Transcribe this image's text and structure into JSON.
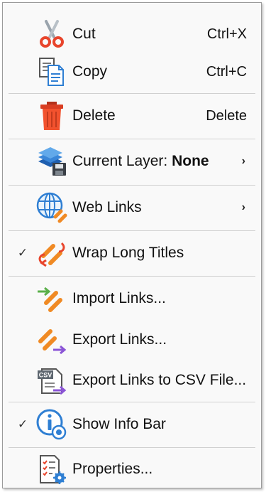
{
  "menu": {
    "cut": {
      "label": "Cut",
      "shortcut": "Ctrl+X"
    },
    "copy": {
      "label": "Copy",
      "shortcut": "Ctrl+C"
    },
    "delete": {
      "label": "Delete",
      "shortcut": "Delete"
    },
    "current_layer": {
      "label": "Current Layer:",
      "value": "None",
      "submenu_arrow": "›"
    },
    "web_links": {
      "label": "Web Links",
      "submenu_arrow": "›"
    },
    "wrap_long_titles": {
      "label": "Wrap Long Titles",
      "checked": true,
      "check_glyph": "✓"
    },
    "import_links": {
      "label": "Import Links..."
    },
    "export_links": {
      "label": "Export Links..."
    },
    "export_links_csv": {
      "label": "Export Links to CSV File...",
      "badge": "CSV"
    },
    "show_info_bar": {
      "label": "Show Info Bar",
      "checked": true,
      "check_glyph": "✓"
    },
    "properties": {
      "label": "Properties..."
    }
  },
  "icons": {
    "cut": "scissors-icon",
    "copy": "copy-icon",
    "delete": "trash-icon",
    "current_layer": "layers-icon",
    "web_links": "globe-link-icon",
    "wrap_long_titles": "chain-wrap-icon",
    "import_links": "import-link-icon",
    "export_links": "export-link-icon",
    "export_links_csv": "csv-export-icon",
    "show_info_bar": "info-bar-icon",
    "properties": "properties-icon"
  },
  "colors": {
    "menu_bg": "#f9f9f9",
    "separator": "#d0d0d0",
    "orange": "#f08a24",
    "red": "#e8452c",
    "blue": "#2f7fd3",
    "purple": "#8b55d6",
    "green": "#5bb04a"
  }
}
